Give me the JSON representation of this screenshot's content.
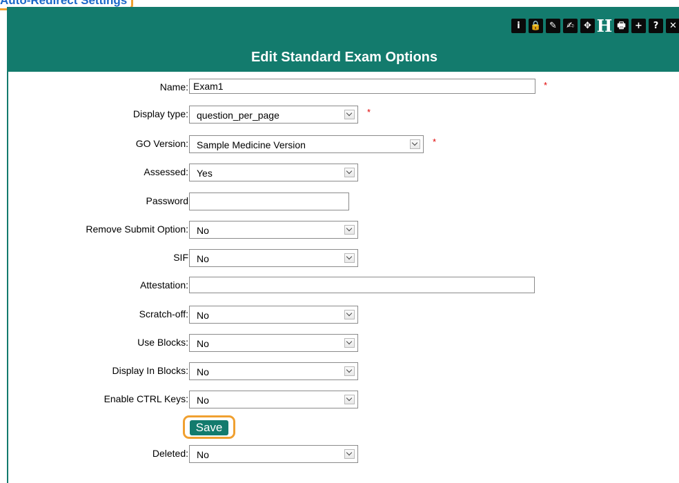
{
  "top_link": "Auto-Redirect Settings",
  "header": {
    "title": "Edit Standard Exam Options"
  },
  "toolbar": [
    {
      "icon": "info-icon",
      "glyph": "i"
    },
    {
      "icon": "lock-icon",
      "glyph": "🔒"
    },
    {
      "icon": "edit-icon",
      "glyph": "✎"
    },
    {
      "icon": "edit-inline-icon",
      "glyph": "✍"
    },
    {
      "icon": "move-icon",
      "glyph": "✥"
    },
    {
      "icon": "heading-icon",
      "glyph": "H"
    },
    {
      "icon": "print-icon",
      "glyph": "🖶"
    },
    {
      "icon": "add-icon",
      "glyph": "+"
    },
    {
      "icon": "help-icon",
      "glyph": "?"
    },
    {
      "icon": "close-icon",
      "glyph": "✕"
    }
  ],
  "form": {
    "name": {
      "label": "Name:",
      "value": "Exam1"
    },
    "display_type": {
      "label": "Display type:",
      "value": "question_per_page"
    },
    "go_version": {
      "label": "GO Version:",
      "value": "Sample Medicine Version"
    },
    "assessed": {
      "label": "Assessed:",
      "value": "Yes"
    },
    "password": {
      "label": "Password",
      "value": ""
    },
    "remove_submit": {
      "label": "Remove Submit Option:",
      "value": "No"
    },
    "sif": {
      "label": "SIF",
      "value": "No"
    },
    "attestation": {
      "label": "Attestation:",
      "value": ""
    },
    "scratch_off": {
      "label": "Scratch-off:",
      "value": "No"
    },
    "use_blocks": {
      "label": "Use Blocks:",
      "value": "No"
    },
    "display_blocks": {
      "label": "Display In Blocks:",
      "value": "No"
    },
    "ctrl_keys": {
      "label": "Enable CTRL Keys:",
      "value": "No"
    },
    "save_label": "Save",
    "deleted": {
      "label": "Deleted:",
      "value": "No"
    },
    "required_mark": "*"
  },
  "colors": {
    "header": "#137b6d",
    "highlight": "#f0a030",
    "link": "#1a66c8",
    "required": "#e00000"
  }
}
